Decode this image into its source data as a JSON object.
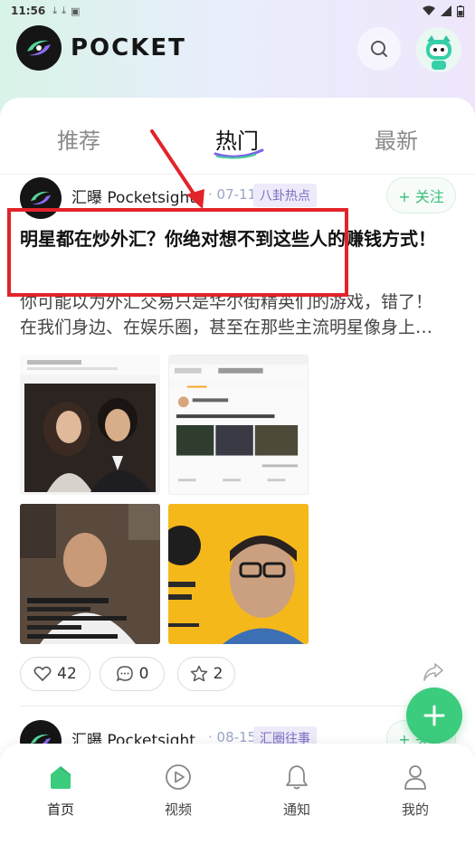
{
  "status_bar": {
    "time": "11:56"
  },
  "app": {
    "logo_text": "POCKET"
  },
  "tabs": [
    {
      "label": "推荐",
      "active": false
    },
    {
      "label": "热门",
      "active": true
    },
    {
      "label": "最新",
      "active": false
    }
  ],
  "posts": [
    {
      "author": "汇曝 Pocketsight",
      "date": "· 07-11",
      "tag": "八卦热点",
      "follow_label": "+ 关注",
      "title": "明星都在炒外汇？你绝对想不到这些人的赚钱方式！",
      "excerpt": "你可能以为外汇交易只是华尔街精英们的游戏，错了！在我们身边、在娱乐圈，甚至在那些主流明星像身上…",
      "likes": "42",
      "comments": "0",
      "favorites": "2"
    },
    {
      "author": "汇曝 Pocketsight",
      "date": "· 08-15",
      "tag": "汇圈往事",
      "follow_label": "+ 关注"
    }
  ],
  "bottom_nav": [
    {
      "label": "首页",
      "active": true
    },
    {
      "label": "视频",
      "active": false
    },
    {
      "label": "通知",
      "active": false
    },
    {
      "label": "我的",
      "active": false
    }
  ],
  "colors": {
    "accent": "#3ccc7e",
    "highlight": "#e2232a",
    "tag_text": "#7a6fc0"
  }
}
